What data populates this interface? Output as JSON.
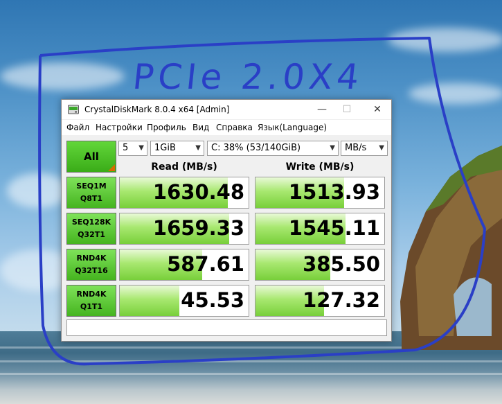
{
  "annotation": {
    "text": "PCIe 2.0X4",
    "color": "#2a3fc6"
  },
  "window": {
    "title": "CrystalDiskMark 8.0.4 x64 [Admin]",
    "controls": {
      "minimize": "—",
      "maximize": "☐",
      "close": "✕"
    }
  },
  "menu": [
    "Файл",
    "Настройки",
    "Профиль",
    "Вид",
    "Справка",
    "Язык(Language)"
  ],
  "toolbar": {
    "all_label": "All",
    "count": "5",
    "size": "1GiB",
    "drive": "C: 38% (53/140GiB)",
    "unit": "MB/s"
  },
  "headers": {
    "read": "Read (MB/s)",
    "write": "Write (MB/s)"
  },
  "tests": [
    {
      "line1": "SEQ1M",
      "line2": "Q8T1",
      "read": "1630.48",
      "write": "1513.93",
      "read_fill": 0.84,
      "write_fill": 0.69
    },
    {
      "line1": "SEQ128K",
      "line2": "Q32T1",
      "read": "1659.33",
      "write": "1545.11",
      "read_fill": 0.85,
      "write_fill": 0.7
    },
    {
      "line1": "RND4K",
      "line2": "Q32T16",
      "read": "587.61",
      "write": "385.50",
      "read_fill": 0.64,
      "write_fill": 0.58
    },
    {
      "line1": "RND4K",
      "line2": "Q1T1",
      "read": "45.53",
      "write": "127.32",
      "read_fill": 0.46,
      "write_fill": 0.53
    }
  ],
  "comment": "",
  "colors": {
    "accent_green": "#45b41f",
    "bar_green": "#78cf3a"
  }
}
